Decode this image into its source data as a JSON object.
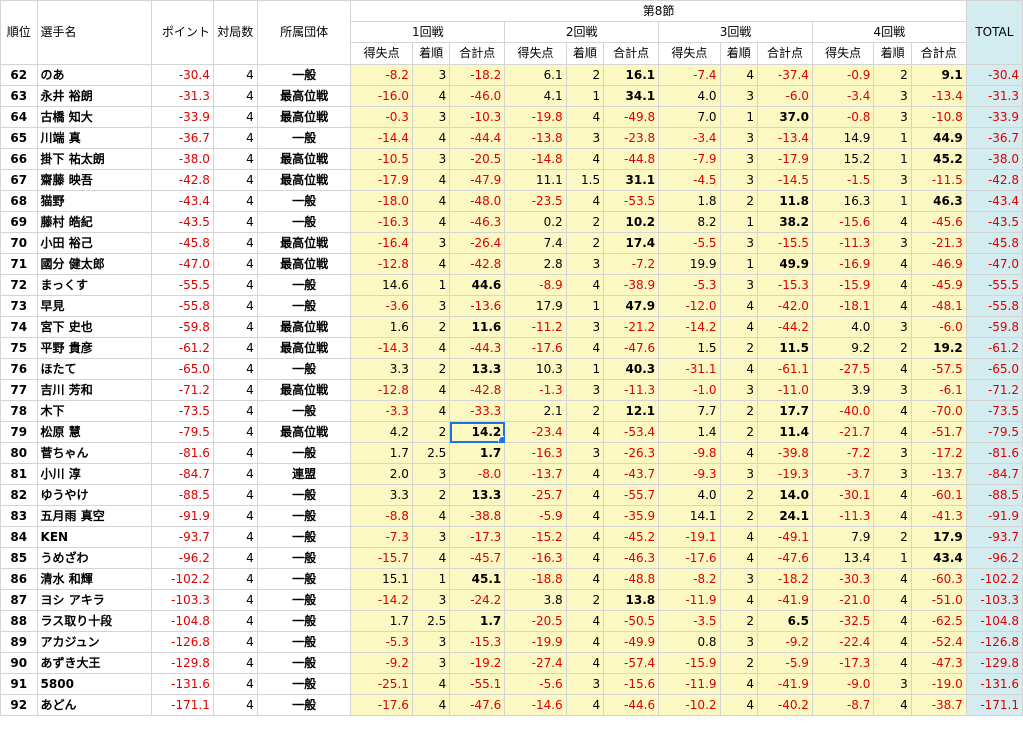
{
  "headers": {
    "rank": "順位",
    "name": "選手名",
    "points": "ポイント",
    "games": "対局数",
    "org": "所属団体",
    "section": "第8節",
    "rounds": [
      "1回戦",
      "2回戦",
      "3回戦",
      "4回戦"
    ],
    "sub": [
      "得失点",
      "着順",
      "合計点"
    ],
    "total": "TOTAL"
  },
  "rows": [
    [
      "62",
      "のあ",
      "-30.4",
      "4",
      "一般",
      "-8.2",
      "3",
      "-18.2",
      "6.1",
      "2",
      "16.1",
      "-7.4",
      "4",
      "-37.4",
      "-0.9",
      "2",
      "9.1",
      "-30.4"
    ],
    [
      "63",
      "永井 裕朗",
      "-31.3",
      "4",
      "最高位戦",
      "-16.0",
      "4",
      "-46.0",
      "4.1",
      "1",
      "34.1",
      "4.0",
      "3",
      "-6.0",
      "-3.4",
      "3",
      "-13.4",
      "-31.3"
    ],
    [
      "64",
      "古橋 知大",
      "-33.9",
      "4",
      "最高位戦",
      "-0.3",
      "3",
      "-10.3",
      "-19.8",
      "4",
      "-49.8",
      "7.0",
      "1",
      "37.0",
      "-0.8",
      "3",
      "-10.8",
      "-33.9"
    ],
    [
      "65",
      "川端 真",
      "-36.7",
      "4",
      "一般",
      "-14.4",
      "4",
      "-44.4",
      "-13.8",
      "3",
      "-23.8",
      "-3.4",
      "3",
      "-13.4",
      "14.9",
      "1",
      "44.9",
      "-36.7"
    ],
    [
      "66",
      "掛下 祐太朗",
      "-38.0",
      "4",
      "最高位戦",
      "-10.5",
      "3",
      "-20.5",
      "-14.8",
      "4",
      "-44.8",
      "-7.9",
      "3",
      "-17.9",
      "15.2",
      "1",
      "45.2",
      "-38.0"
    ],
    [
      "67",
      "齋藤 映吾",
      "-42.8",
      "4",
      "最高位戦",
      "-17.9",
      "4",
      "-47.9",
      "11.1",
      "1.5",
      "31.1",
      "-4.5",
      "3",
      "-14.5",
      "-1.5",
      "3",
      "-11.5",
      "-42.8"
    ],
    [
      "68",
      "猫野",
      "-43.4",
      "4",
      "一般",
      "-18.0",
      "4",
      "-48.0",
      "-23.5",
      "4",
      "-53.5",
      "1.8",
      "2",
      "11.8",
      "16.3",
      "1",
      "46.3",
      "-43.4"
    ],
    [
      "69",
      "藤村 皓紀",
      "-43.5",
      "4",
      "一般",
      "-16.3",
      "4",
      "-46.3",
      "0.2",
      "2",
      "10.2",
      "8.2",
      "1",
      "38.2",
      "-15.6",
      "4",
      "-45.6",
      "-43.5"
    ],
    [
      "70",
      "小田 裕己",
      "-45.8",
      "4",
      "最高位戦",
      "-16.4",
      "3",
      "-26.4",
      "7.4",
      "2",
      "17.4",
      "-5.5",
      "3",
      "-15.5",
      "-11.3",
      "3",
      "-21.3",
      "-45.8"
    ],
    [
      "71",
      "國分 健太郎",
      "-47.0",
      "4",
      "最高位戦",
      "-12.8",
      "4",
      "-42.8",
      "2.8",
      "3",
      "-7.2",
      "19.9",
      "1",
      "49.9",
      "-16.9",
      "4",
      "-46.9",
      "-47.0"
    ],
    [
      "72",
      "まっくす",
      "-55.5",
      "4",
      "一般",
      "14.6",
      "1",
      "44.6",
      "-8.9",
      "4",
      "-38.9",
      "-5.3",
      "3",
      "-15.3",
      "-15.9",
      "4",
      "-45.9",
      "-55.5"
    ],
    [
      "73",
      "早見",
      "-55.8",
      "4",
      "一般",
      "-3.6",
      "3",
      "-13.6",
      "17.9",
      "1",
      "47.9",
      "-12.0",
      "4",
      "-42.0",
      "-18.1",
      "4",
      "-48.1",
      "-55.8"
    ],
    [
      "74",
      "宮下 史也",
      "-59.8",
      "4",
      "最高位戦",
      "1.6",
      "2",
      "11.6",
      "-11.2",
      "3",
      "-21.2",
      "-14.2",
      "4",
      "-44.2",
      "4.0",
      "3",
      "-6.0",
      "-59.8"
    ],
    [
      "75",
      "平野 貴彦",
      "-61.2",
      "4",
      "最高位戦",
      "-14.3",
      "4",
      "-44.3",
      "-17.6",
      "4",
      "-47.6",
      "1.5",
      "2",
      "11.5",
      "9.2",
      "2",
      "19.2",
      "-61.2"
    ],
    [
      "76",
      "ほたて",
      "-65.0",
      "4",
      "一般",
      "3.3",
      "2",
      "13.3",
      "10.3",
      "1",
      "40.3",
      "-31.1",
      "4",
      "-61.1",
      "-27.5",
      "4",
      "-57.5",
      "-65.0"
    ],
    [
      "77",
      "吉川 芳和",
      "-71.2",
      "4",
      "最高位戦",
      "-12.8",
      "4",
      "-42.8",
      "-1.3",
      "3",
      "-11.3",
      "-1.0",
      "3",
      "-11.0",
      "3.9",
      "3",
      "-6.1",
      "-71.2"
    ],
    [
      "78",
      "木下",
      "-73.5",
      "4",
      "一般",
      "-3.3",
      "4",
      "-33.3",
      "2.1",
      "2",
      "12.1",
      "7.7",
      "2",
      "17.7",
      "-40.0",
      "4",
      "-70.0",
      "-73.5"
    ],
    [
      "79",
      "松原 慧",
      "-79.5",
      "4",
      "最高位戦",
      "4.2",
      "2",
      "14.2",
      "-23.4",
      "4",
      "-53.4",
      "1.4",
      "2",
      "11.4",
      "-21.7",
      "4",
      "-51.7",
      "-79.5"
    ],
    [
      "80",
      "菅ちゃん",
      "-81.6",
      "4",
      "一般",
      "1.7",
      "2.5",
      "1.7",
      "-16.3",
      "3",
      "-26.3",
      "-9.8",
      "4",
      "-39.8",
      "-7.2",
      "3",
      "-17.2",
      "-81.6"
    ],
    [
      "81",
      "小川 淳",
      "-84.7",
      "4",
      "連盟",
      "2.0",
      "3",
      "-8.0",
      "-13.7",
      "4",
      "-43.7",
      "-9.3",
      "3",
      "-19.3",
      "-3.7",
      "3",
      "-13.7",
      "-84.7"
    ],
    [
      "82",
      "ゆうやけ",
      "-88.5",
      "4",
      "一般",
      "3.3",
      "2",
      "13.3",
      "-25.7",
      "4",
      "-55.7",
      "4.0",
      "2",
      "14.0",
      "-30.1",
      "4",
      "-60.1",
      "-88.5"
    ],
    [
      "83",
      "五月雨 真空",
      "-91.9",
      "4",
      "一般",
      "-8.8",
      "4",
      "-38.8",
      "-5.9",
      "4",
      "-35.9",
      "14.1",
      "2",
      "24.1",
      "-11.3",
      "4",
      "-41.3",
      "-91.9"
    ],
    [
      "84",
      "KEN",
      "-93.7",
      "4",
      "一般",
      "-7.3",
      "3",
      "-17.3",
      "-15.2",
      "4",
      "-45.2",
      "-19.1",
      "4",
      "-49.1",
      "7.9",
      "2",
      "17.9",
      "-93.7"
    ],
    [
      "85",
      "うめざわ",
      "-96.2",
      "4",
      "一般",
      "-15.7",
      "4",
      "-45.7",
      "-16.3",
      "4",
      "-46.3",
      "-17.6",
      "4",
      "-47.6",
      "13.4",
      "1",
      "43.4",
      "-96.2"
    ],
    [
      "86",
      "清水 和輝",
      "-102.2",
      "4",
      "一般",
      "15.1",
      "1",
      "45.1",
      "-18.8",
      "4",
      "-48.8",
      "-8.2",
      "3",
      "-18.2",
      "-30.3",
      "4",
      "-60.3",
      "-102.2"
    ],
    [
      "87",
      "ヨシ アキラ",
      "-103.3",
      "4",
      "一般",
      "-14.2",
      "3",
      "-24.2",
      "3.8",
      "2",
      "13.8",
      "-11.9",
      "4",
      "-41.9",
      "-21.0",
      "4",
      "-51.0",
      "-103.3"
    ],
    [
      "88",
      "ラス取り十段",
      "-104.8",
      "4",
      "一般",
      "1.7",
      "2.5",
      "1.7",
      "-20.5",
      "4",
      "-50.5",
      "-3.5",
      "2",
      "6.5",
      "-32.5",
      "4",
      "-62.5",
      "-104.8"
    ],
    [
      "89",
      "アカジュン",
      "-126.8",
      "4",
      "一般",
      "-5.3",
      "3",
      "-15.3",
      "-19.9",
      "4",
      "-49.9",
      "0.8",
      "3",
      "-9.2",
      "-22.4",
      "4",
      "-52.4",
      "-126.8"
    ],
    [
      "90",
      "あずき大王",
      "-129.8",
      "4",
      "一般",
      "-9.2",
      "3",
      "-19.2",
      "-27.4",
      "4",
      "-57.4",
      "-15.9",
      "2",
      "-5.9",
      "-17.3",
      "4",
      "-47.3",
      "-129.8"
    ],
    [
      "91",
      "5800",
      "-131.6",
      "4",
      "一般",
      "-25.1",
      "4",
      "-55.1",
      "-5.6",
      "3",
      "-15.6",
      "-11.9",
      "4",
      "-41.9",
      "-9.0",
      "3",
      "-19.0",
      "-131.6"
    ],
    [
      "92",
      "あどん",
      "-171.1",
      "4",
      "一般",
      "-17.6",
      "4",
      "-47.6",
      "-14.6",
      "4",
      "-44.6",
      "-10.2",
      "4",
      "-40.2",
      "-8.7",
      "4",
      "-38.7",
      "-171.1"
    ]
  ],
  "selected_cell": {
    "row": "79",
    "column": "1回戦 合計点"
  },
  "colors": {
    "negative": "#d00000",
    "round_bg": "#fcf8c2",
    "total_bg": "#d2ecef",
    "selection": "#1a73e8",
    "grid": "#d4d4d4"
  }
}
